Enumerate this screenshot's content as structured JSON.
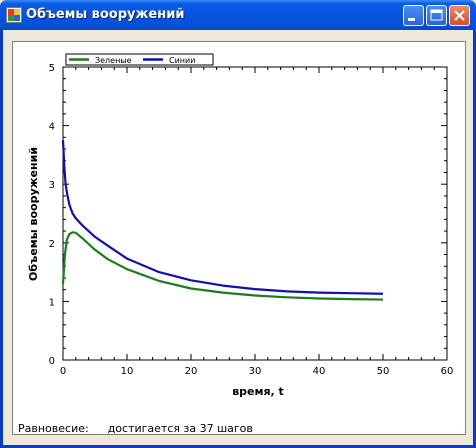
{
  "window": {
    "title": "Объемы вооружений"
  },
  "chart_data": {
    "type": "line",
    "ylabel": "Объемы вооружений",
    "xlabel": "время, t",
    "xlim": [
      0,
      60
    ],
    "ylim": [
      0,
      5
    ],
    "x_ticks": [
      "0",
      "10",
      "20",
      "30",
      "40",
      "50",
      "60"
    ],
    "y_ticks": [
      "0",
      "1",
      "2",
      "3",
      "4",
      "5"
    ],
    "grid": false,
    "legend_position": "top-left",
    "series": [
      {
        "name": "Зеленые",
        "color": "#1E7B1E",
        "x": [
          0,
          0.3,
          0.6,
          1.0,
          1.5,
          2,
          3,
          4,
          5,
          7,
          10,
          15,
          20,
          25,
          30,
          35,
          40,
          45,
          50
        ],
        "y": [
          1.3,
          1.8,
          2.05,
          2.15,
          2.18,
          2.17,
          2.08,
          1.98,
          1.88,
          1.72,
          1.55,
          1.35,
          1.22,
          1.15,
          1.1,
          1.07,
          1.05,
          1.04,
          1.03
        ]
      },
      {
        "name": "Синии",
        "color": "#0F0FB4",
        "x": [
          0,
          0.2,
          0.4,
          0.7,
          1.0,
          1.5,
          2,
          3,
          4,
          5,
          7,
          10,
          15,
          20,
          25,
          30,
          35,
          40,
          45,
          50
        ],
        "y": [
          3.75,
          3.3,
          3.0,
          2.8,
          2.65,
          2.5,
          2.42,
          2.3,
          2.2,
          2.1,
          1.95,
          1.73,
          1.5,
          1.36,
          1.27,
          1.21,
          1.17,
          1.15,
          1.14,
          1.13
        ]
      }
    ]
  },
  "status": {
    "label": "Равновесие:",
    "value": "достигается за 37 шагов"
  }
}
